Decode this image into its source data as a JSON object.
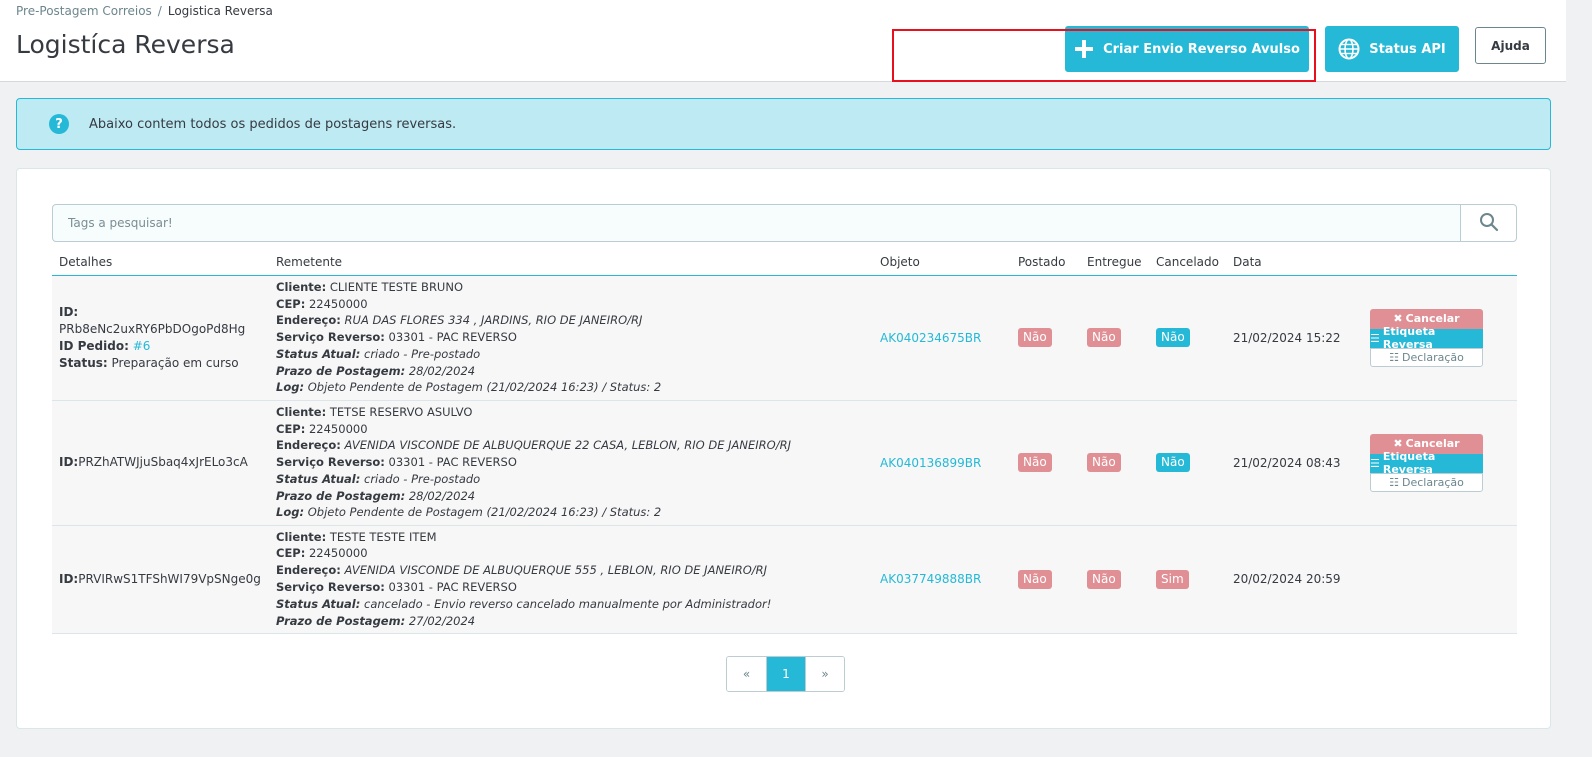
{
  "breadcrumb": {
    "parent": "Pre-Postagem Correios",
    "separator": "/",
    "current": "Logistica Reversa"
  },
  "page_title": "Logistíca Reversa",
  "toolbar": {
    "create_label": "Criar Envio Reverso Avulso",
    "status_label": "Status API",
    "help_label": "Ajuda"
  },
  "alert": {
    "text": "Abaixo contem todos os pedidos de postagens reversas.",
    "icon": "question-circle-icon"
  },
  "search": {
    "placeholder": "Tags a pesquisar!",
    "icon": "search-icon"
  },
  "table": {
    "columns": [
      "Detalhes",
      "Remetente",
      "Objeto",
      "Postado",
      "Entregue",
      "Cancelado",
      "Data"
    ],
    "rows": [
      {
        "id_label": "ID:",
        "id": "PRb8eNc2uxRY6PbDOgoPd8Hg",
        "pedido_label": "ID Pedido:",
        "pedido": "#6",
        "status_label": "Status:",
        "status": "Preparação em curso",
        "cliente_label": "Cliente:",
        "cliente": "CLIENTE TESTE BRUNO",
        "cep_label": "CEP:",
        "cep": "22450000",
        "endereco_label": "Endereço:",
        "endereco": "RUA DAS FLORES 334 , JARDINS, RIO DE JANEIRO/RJ",
        "servico_label": "Serviço Reverso:",
        "servico": "03301 - PAC REVERSO",
        "status_atual_label": "Status Atual:",
        "status_atual": "criado - Pre-postado",
        "prazo_label": "Prazo de Postagem:",
        "prazo": "28/02/2024",
        "log_label": "Log:",
        "log": "Objeto Pendente de Postagem (21/02/2024 16:23) / Status: 2",
        "objeto": "AK040234675BR",
        "postado": "Não",
        "entregue": "Não",
        "cancelado": "Não",
        "data": "21/02/2024 15:22",
        "btn_cancel": "Cancelar",
        "btn_label": "Etiqueta Reversa",
        "btn_decl": "Declaração"
      },
      {
        "id_label": "ID:",
        "id": "PRZhATWJjuSbaq4xJrELo3cA",
        "cliente_label": "Cliente:",
        "cliente": "TETSE RESERVO ASULVO",
        "cep_label": "CEP:",
        "cep": "22450000",
        "endereco_label": "Endereço:",
        "endereco": "AVENIDA VISCONDE DE ALBUQUERQUE 22 CASA, LEBLON, RIO DE JANEIRO/RJ",
        "servico_label": "Serviço Reverso:",
        "servico": "03301 - PAC REVERSO",
        "status_atual_label": "Status Atual:",
        "status_atual": "criado - Pre-postado",
        "prazo_label": "Prazo de Postagem:",
        "prazo": "28/02/2024",
        "log_label": "Log:",
        "log": "Objeto Pendente de Postagem (21/02/2024 16:23) / Status: 2",
        "objeto": "AK040136899BR",
        "postado": "Não",
        "entregue": "Não",
        "cancelado": "Não",
        "data": "21/02/2024 08:43",
        "btn_cancel": "Cancelar",
        "btn_label": "Etiqueta Reversa",
        "btn_decl": "Declaração"
      },
      {
        "id_label": "ID:",
        "id": "PRVIRwS1TFShWI79VpSNge0g",
        "cliente_label": "Cliente:",
        "cliente": "TESTE TESTE ITEM",
        "cep_label": "CEP:",
        "cep": "22450000",
        "endereco_label": "Endereço:",
        "endereco": "AVENIDA VISCONDE DE ALBUQUERQUE 555 , LEBLON, RIO DE JANEIRO/RJ",
        "servico_label": "Serviço Reverso:",
        "servico": "03301 - PAC REVERSO",
        "status_atual_label": "Status Atual:",
        "status_atual": "cancelado - Envio reverso cancelado manualmente por Administrador!",
        "prazo_label": "Prazo de Postagem:",
        "prazo": "27/02/2024",
        "objeto": "AK037749888BR",
        "postado": "Não",
        "entregue": "Não",
        "cancelado": "Sim",
        "data": "20/02/2024 20:59"
      }
    ]
  },
  "pagination": {
    "prev": "«",
    "current": "1",
    "next": "»"
  },
  "colors": {
    "accent": "#25b9d7",
    "danger": "#e08f95",
    "highlight": "#e8101e"
  }
}
